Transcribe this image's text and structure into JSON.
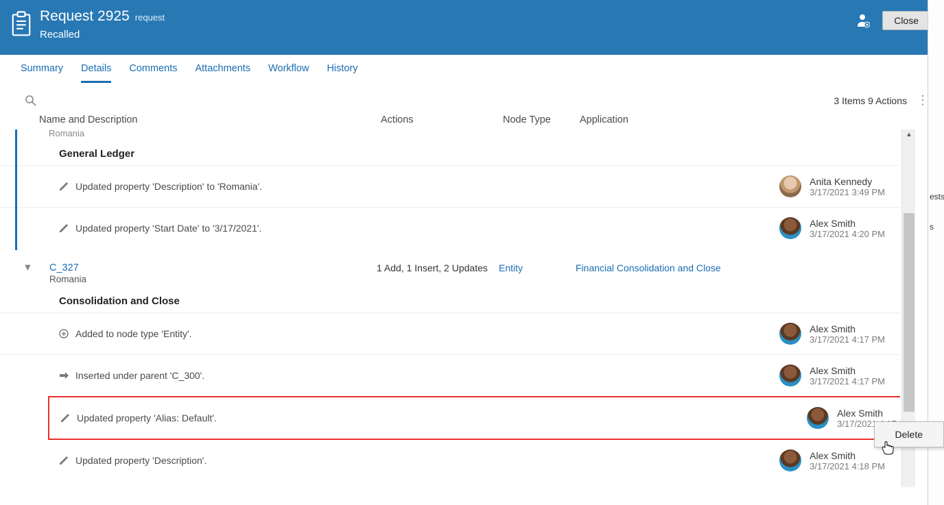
{
  "header": {
    "title": "Request 2925",
    "subtype": "request",
    "status": "Recalled",
    "close_label": "Close"
  },
  "tabs": {
    "summary": "Summary",
    "details": "Details",
    "comments": "Comments",
    "attachments": "Attachments",
    "workflow": "Workflow",
    "history": "History"
  },
  "toolbar": {
    "summary": "3 Items 9 Actions"
  },
  "columns": {
    "name": "Name and Description",
    "actions": "Actions",
    "nodetype": "Node Type",
    "application": "Application"
  },
  "group1": {
    "sub": "Romania",
    "section": "General Ledger",
    "rows": [
      {
        "text": "Updated property 'Description' to 'Romania'.",
        "user": "Anita Kennedy",
        "time": "3/17/2021 3:49 PM",
        "avatar": "anita"
      },
      {
        "text": "Updated property 'Start Date' to '3/17/2021'.",
        "user": "Alex Smith",
        "time": "3/17/2021 4:20 PM",
        "avatar": "alex"
      }
    ]
  },
  "item2": {
    "name": "C_327",
    "sub": "Romania",
    "actions": "1 Add, 1 Insert, 2 Updates",
    "nodetype": "Entity",
    "application": "Financial Consolidation and Close",
    "section": "Consolidation and Close",
    "rows": [
      {
        "icon": "add",
        "text": "Added to node type 'Entity'.",
        "user": "Alex Smith",
        "time": "3/17/2021 4:17 PM",
        "avatar": "alex"
      },
      {
        "icon": "insert",
        "text": "Inserted under parent 'C_300'.",
        "user": "Alex Smith",
        "time": "3/17/2021 4:17 PM",
        "avatar": "alex"
      },
      {
        "icon": "edit",
        "text": "Updated property 'Alias: Default'.",
        "user": "Alex Smith",
        "time": "3/17/2021 4:17 PM",
        "avatar": "alex",
        "highlighted": true
      },
      {
        "icon": "edit",
        "text": "Updated property 'Description'.",
        "user": "Alex Smith",
        "time": "3/17/2021 4:18 PM",
        "avatar": "alex"
      }
    ]
  },
  "context_menu": {
    "delete": "Delete"
  },
  "right_strip": {
    "t1": "ests",
    "t2": "s"
  }
}
